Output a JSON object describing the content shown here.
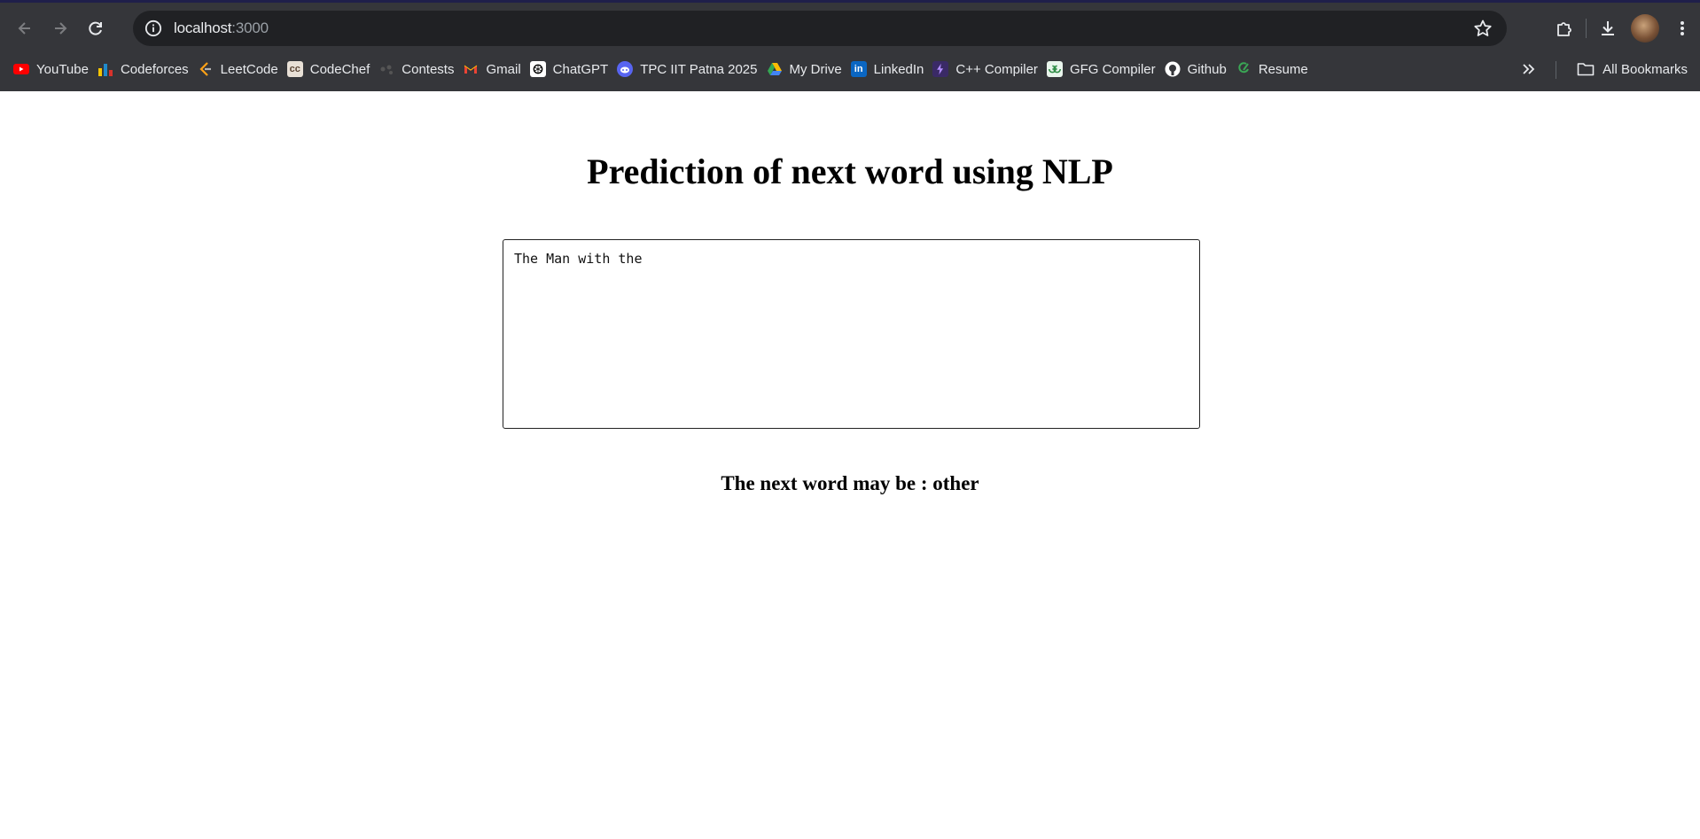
{
  "browser": {
    "url_host": "localhost",
    "url_port": ":3000",
    "bookmarks": [
      {
        "label": "YouTube",
        "icon": "youtube-icon",
        "color": "#ff0000"
      },
      {
        "label": "Codeforces",
        "icon": "codeforces-icon",
        "color": "#1f8acb"
      },
      {
        "label": "LeetCode",
        "icon": "leetcode-icon",
        "color": "#ffa116"
      },
      {
        "label": "CodeChef",
        "icon": "codechef-icon",
        "color": "#8a6e58"
      },
      {
        "label": "Contests",
        "icon": "contests-icon",
        "color": "#6b6b6b"
      },
      {
        "label": "Gmail",
        "icon": "gmail-icon",
        "color": "#ea4335"
      },
      {
        "label": "ChatGPT",
        "icon": "chatgpt-icon",
        "color": "#ffffff"
      },
      {
        "label": "TPC IIT Patna 2025",
        "icon": "discord-icon",
        "color": "#5865f2"
      },
      {
        "label": "My Drive",
        "icon": "google-drive-icon",
        "color": "#34a853"
      },
      {
        "label": "LinkedIn",
        "icon": "linkedin-icon",
        "color": "#0a66c2"
      },
      {
        "label": "C++ Compiler",
        "icon": "compiler-icon",
        "color": "#6c3bbf"
      },
      {
        "label": "GFG Compiler",
        "icon": "gfg-icon",
        "color": "#2f8d46"
      },
      {
        "label": "Github",
        "icon": "github-icon",
        "color": "#ffffff"
      },
      {
        "label": "Resume",
        "icon": "resume-icon",
        "color": "#3aa655"
      }
    ],
    "all_bookmarks_label": "All Bookmarks"
  },
  "page": {
    "title": "Prediction of next word using NLP",
    "input_value": "The Man with the",
    "prediction_text": "The next word may be : other"
  }
}
